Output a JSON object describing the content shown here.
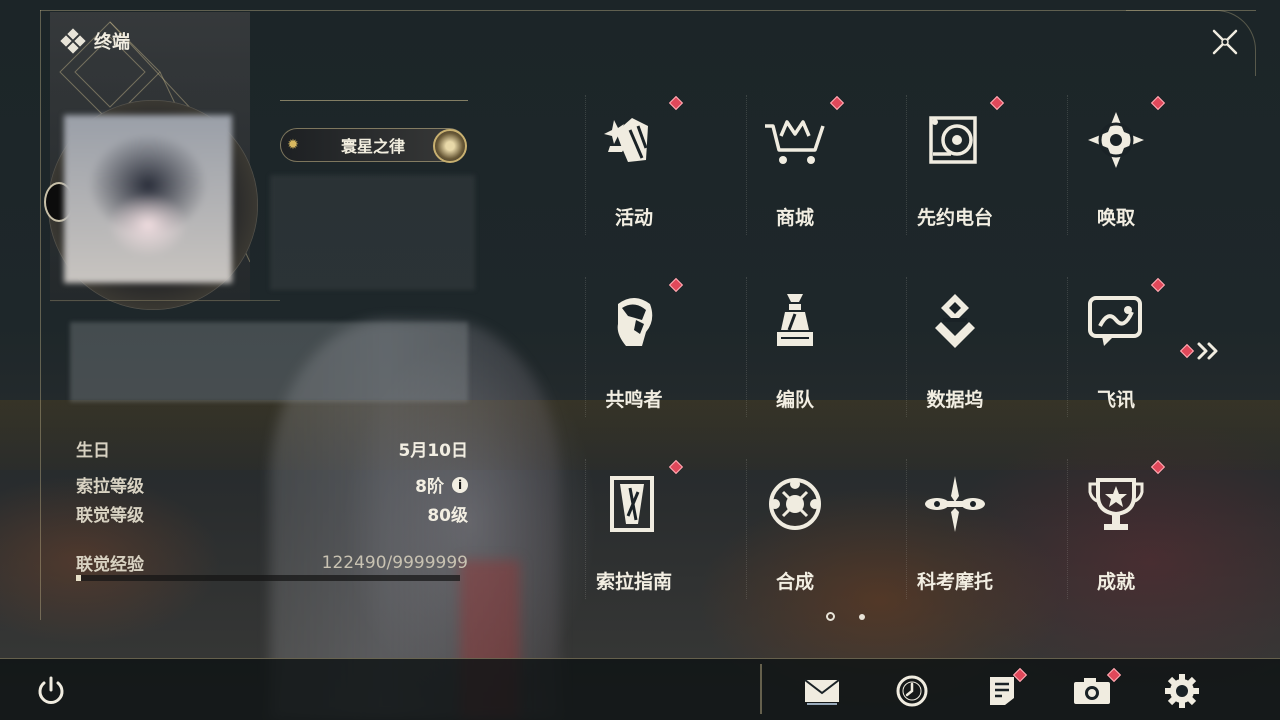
{
  "header": {
    "title": "终端"
  },
  "profile": {
    "title_badge": "寰星之律",
    "stats": [
      {
        "label": "生日",
        "value": "5月10日"
      },
      {
        "label": "索拉等级",
        "value": "8阶"
      },
      {
        "label": "联觉等级",
        "value": "80级"
      },
      {
        "label": "联觉经验",
        "value": "122490/9999999"
      }
    ],
    "exp_progress": 0.012
  },
  "menu": [
    {
      "label": "活动",
      "icon": "activity-icon",
      "badge": true
    },
    {
      "label": "商城",
      "icon": "shop-cart-icon",
      "badge": true
    },
    {
      "label": "先约电台",
      "icon": "radio-icon",
      "badge": true
    },
    {
      "label": "唤取",
      "icon": "convene-icon",
      "badge": true
    },
    {
      "label": "共鸣者",
      "icon": "resonator-icon",
      "badge": true
    },
    {
      "label": "编队",
      "icon": "team-chess-icon",
      "badge": false
    },
    {
      "label": "数据坞",
      "icon": "data-bank-icon",
      "badge": false
    },
    {
      "label": "飞讯",
      "icon": "message-icon",
      "badge": true
    },
    {
      "label": "索拉指南",
      "icon": "guidebook-icon",
      "badge": true
    },
    {
      "label": "合成",
      "icon": "synthesis-icon",
      "badge": false
    },
    {
      "label": "科考摩托",
      "icon": "motorcycle-icon",
      "badge": false
    },
    {
      "label": "成就",
      "icon": "trophy-icon",
      "badge": true
    }
  ],
  "pager": {
    "pages": 2,
    "current": 1
  },
  "bottom_bar": [
    {
      "name": "power-icon"
    },
    {
      "name": "mail-icon"
    },
    {
      "name": "clock-icon"
    },
    {
      "name": "notes-icon",
      "badge": true
    },
    {
      "name": "camera-icon",
      "badge": true
    },
    {
      "name": "settings-icon"
    }
  ],
  "colors": {
    "accent": "#c8b070",
    "badge": "#e0485a",
    "text": "#f2eee2"
  }
}
